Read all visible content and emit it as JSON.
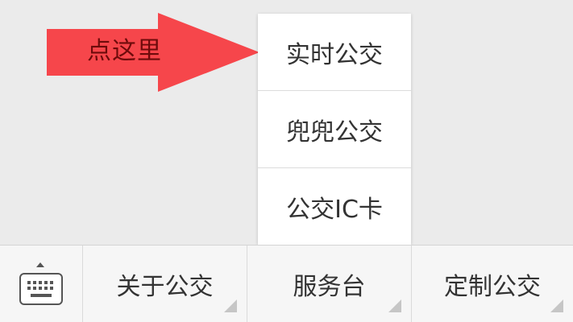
{
  "annotation": {
    "label": "点这里",
    "arrow_color": "#f6464b",
    "label_color": "#6e0b0b"
  },
  "popup_menu": {
    "items": [
      {
        "label": "实时公交"
      },
      {
        "label": "兜兜公交"
      },
      {
        "label": "公交IC卡"
      }
    ]
  },
  "bottom_bar": {
    "keyboard_icon": "keyboard-icon",
    "tabs": [
      {
        "label": "关于公交",
        "indicator_icon": "submenu-corner-icon"
      },
      {
        "label": "服务台",
        "indicator_icon": "submenu-corner-icon"
      },
      {
        "label": "定制公交",
        "indicator_icon": "submenu-corner-icon"
      }
    ]
  },
  "colors": {
    "background": "#ebebeb",
    "popup_background": "#ffffff",
    "bar_background": "#f6f6f6",
    "text": "#333333"
  }
}
